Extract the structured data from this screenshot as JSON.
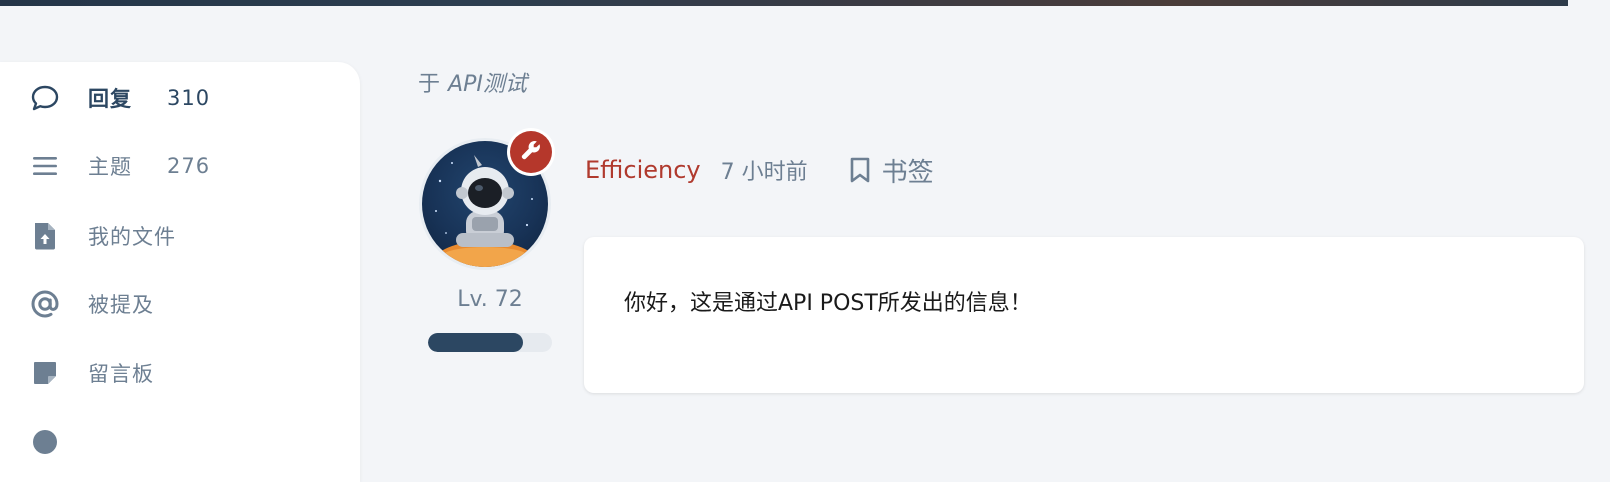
{
  "sidebar": {
    "items": [
      {
        "icon": "comment-icon",
        "label": "回复",
        "count": "310",
        "active": true
      },
      {
        "icon": "list-icon",
        "label": "主题",
        "count": "276",
        "active": false
      },
      {
        "icon": "file-upload-icon",
        "label": "我的文件",
        "count": "",
        "active": false
      },
      {
        "icon": "at-icon",
        "label": "被提及",
        "count": "",
        "active": false
      },
      {
        "icon": "sticky-note-icon",
        "label": "留言板",
        "count": "",
        "active": false
      }
    ]
  },
  "context": {
    "prefix": "于",
    "category": "API测试"
  },
  "post": {
    "author": "Efficiency",
    "time": "7 小时前",
    "bookmark_label": "书签",
    "body": "你好，这是通过API POST所发出的信息！"
  },
  "user": {
    "level_label": "Lv. 72",
    "level_progress": 0.77,
    "badge_icon": "wrench-icon"
  },
  "colors": {
    "accent": "#2c4762",
    "author": "#b03a2e",
    "badge": "#b5372b",
    "muted": "#6d7f92",
    "background": "#f3f5f8"
  }
}
